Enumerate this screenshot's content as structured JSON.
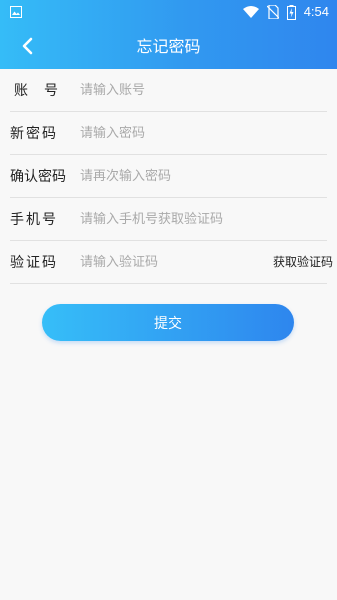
{
  "status_bar": {
    "time": "4:54",
    "icons": [
      "gallery-icon",
      "wifi-icon",
      "no-sim-icon",
      "battery-charging-icon"
    ]
  },
  "header": {
    "title": "忘记密码",
    "back_icon": "chevron-left-icon",
    "gradient": [
      "#35bcf7",
      "#2f86ee"
    ]
  },
  "form": {
    "account": {
      "label": "账号",
      "placeholder": "请输入账号"
    },
    "new_password": {
      "label": "新密码",
      "placeholder": "请输入密码"
    },
    "confirm_password": {
      "label": "确认密码",
      "placeholder": "请再次输入密码"
    },
    "phone": {
      "label": "手机号",
      "placeholder": "请输入手机号获取验证码"
    },
    "code": {
      "label": "验证码",
      "placeholder": "请输入验证码",
      "get_code": "获取验证码"
    }
  },
  "submit_label": "提交"
}
